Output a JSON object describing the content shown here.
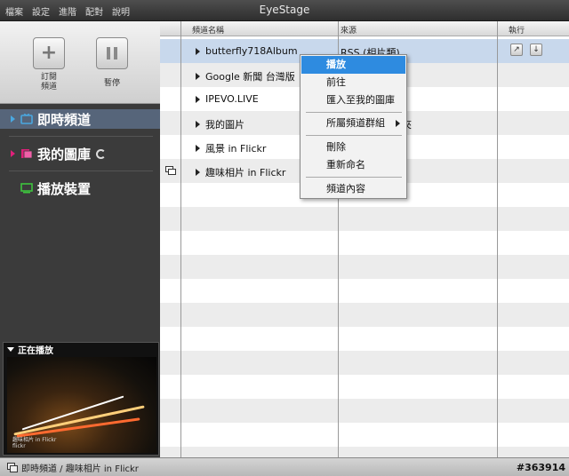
{
  "window": {
    "title": "EyeStage"
  },
  "menu": [
    "檔案",
    "設定",
    "進階",
    "配對",
    "說明"
  ],
  "toolbar": {
    "subscribe_label": "訂閱\n頻道",
    "pause_label": "暫停"
  },
  "sidebar": {
    "items": [
      {
        "label": "即時頻道",
        "active": true
      },
      {
        "label": "我的圖庫",
        "active": false
      },
      {
        "label": "播放裝置",
        "active": false
      }
    ],
    "now_playing": {
      "header": "正在播放",
      "caption_line1": "趣味相片 in Flickr",
      "caption_line2": "flickr"
    }
  },
  "table": {
    "headers": {
      "name": "頻道名稱",
      "source": "來源",
      "action": "執行"
    },
    "rows": [
      {
        "name": "butterfly718Album",
        "source": "RSS (相片類)"
      },
      {
        "name": "Google 新聞 台灣版",
        "source": ")"
      },
      {
        "name": "IPEVO.LIVE",
        "source": ")"
      },
      {
        "name": "我的圖片",
        "source": "夾"
      },
      {
        "name": "風景 in Flickr",
        "source": ""
      },
      {
        "name": "趣味相片 in Flickr",
        "source": ""
      }
    ]
  },
  "context_menu": {
    "items": [
      {
        "label": "播放"
      },
      {
        "label": "前往"
      },
      {
        "label": "匯入至我的圖庫"
      },
      {
        "label": "所屬頻道群組"
      },
      {
        "label": "刪除"
      },
      {
        "label": "重新命名"
      },
      {
        "label": "頻道內容"
      }
    ]
  },
  "statusbar": {
    "path": "即時頻道 / 趣味相片 in Flickr",
    "id": "#363914"
  },
  "colors": {
    "accent": "#2e8be0",
    "sidebar_active": "#56657a",
    "selected_row": "#c8d8ec"
  }
}
